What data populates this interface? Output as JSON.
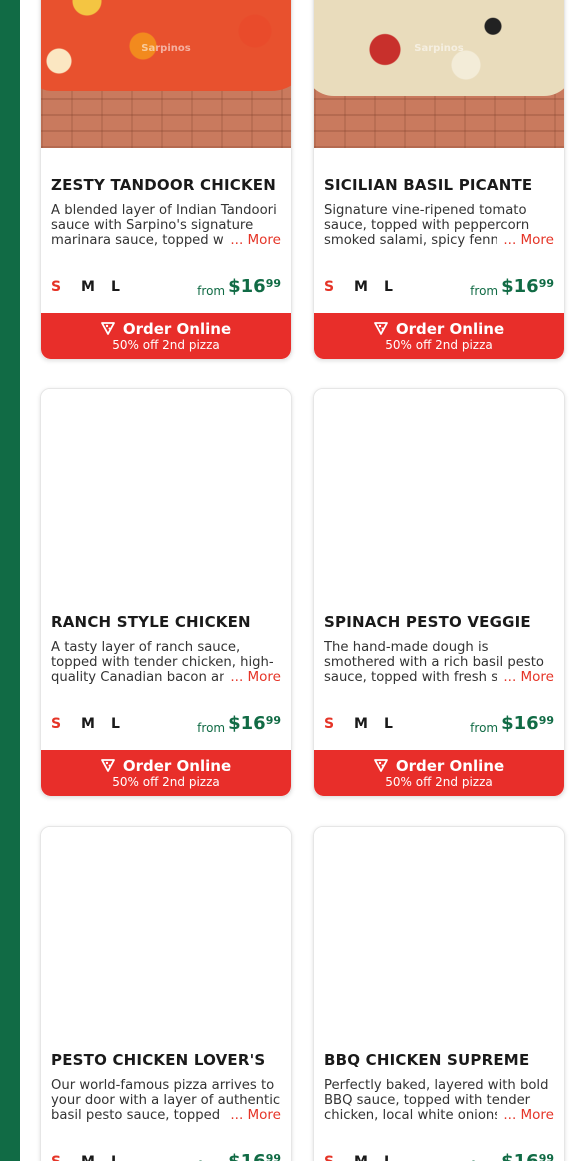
{
  "watermark": "Sarpinos",
  "order": {
    "label": "Order Online",
    "promo": "50% off 2nd pizza"
  },
  "more_label": "... More",
  "from_label": "from",
  "sizes": [
    "S",
    "M",
    "L"
  ],
  "products": [
    {
      "title": "ZESTY TANDOOR CHICKEN",
      "description": "A blended layer of Indian Tandoori sauce with Sarpino's signature marinara sauce, topped with tender chicken",
      "price_dollars": "$16",
      "price_cents": "99"
    },
    {
      "title": "SICILIAN BASIL PICANTE",
      "description": "Signature vine-ripened tomato sauce, topped with peppercorn smoked salami, spicy fennel Italian sausage",
      "price_dollars": "$16",
      "price_cents": "99"
    },
    {
      "title": "RANCH STYLE CHICKEN",
      "description": "A tasty layer of ranch sauce, topped with tender chicken, high-quality Canadian bacon and mozzarella",
      "price_dollars": "$16",
      "price_cents": "99"
    },
    {
      "title": "SPINACH PESTO VEGGIE",
      "description": "The hand-made dough is smothered with a rich basil pesto sauce, topped with fresh spinach",
      "price_dollars": "$16",
      "price_cents": "99"
    },
    {
      "title": "PESTO CHICKEN LOVER'S",
      "description": "Our world-famous pizza arrives to your door with a layer of authentic basil pesto sauce, topped with chicken",
      "price_dollars": "$16",
      "price_cents": "99"
    },
    {
      "title": "BBQ CHICKEN SUPREME",
      "description": "Perfectly baked, layered with bold BBQ sauce, topped with tender chicken, local white onions and cheese",
      "price_dollars": "$16",
      "price_cents": "99"
    }
  ],
  "colors": {
    "brand_green": "#116b45",
    "brand_red": "#e82e2a"
  }
}
